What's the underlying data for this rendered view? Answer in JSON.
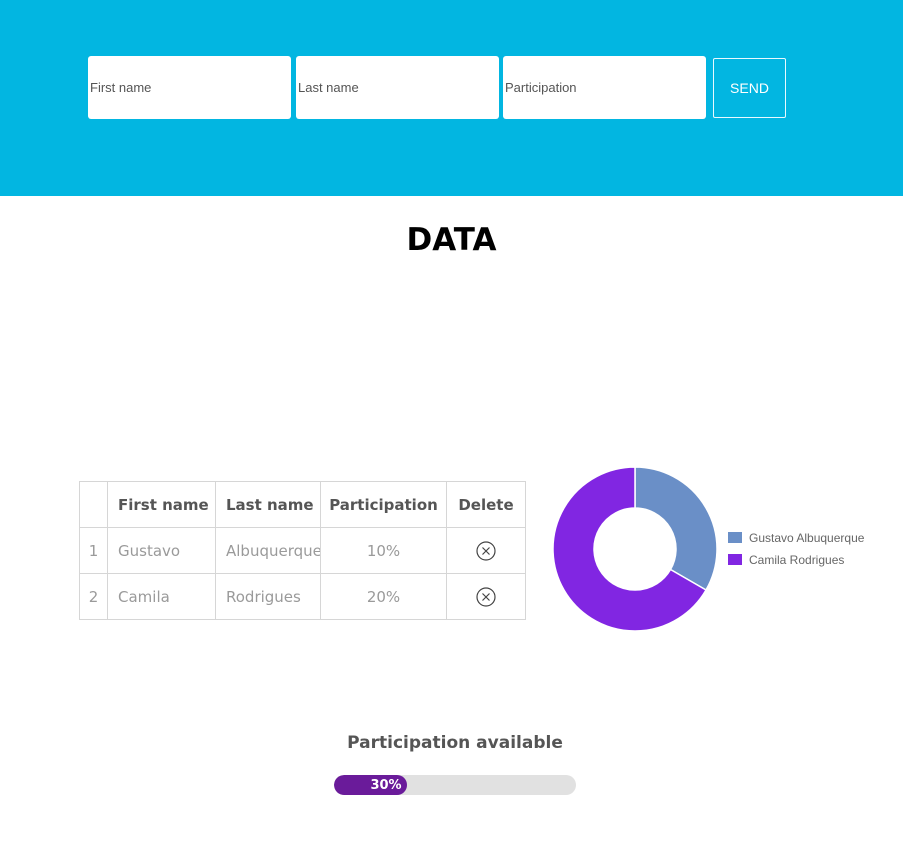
{
  "form": {
    "first_name_placeholder": "First name",
    "last_name_placeholder": "Last name",
    "participation_placeholder": "Participation",
    "send_label": "SEND"
  },
  "colors": {
    "header_bg": "#02b6e1",
    "series_1": "#6a8fc7",
    "series_2": "#8126e2",
    "progress": "#6a1b9a"
  },
  "title": "DATA",
  "table": {
    "headers": [
      "",
      "First name",
      "Last name",
      "Participation",
      "Delete"
    ],
    "rows": [
      {
        "index": "1",
        "first_name": "Gustavo",
        "last_name": "Albuquerque",
        "participation": "10%",
        "delete_icon": "circle-x-icon"
      },
      {
        "index": "2",
        "first_name": "Camila",
        "last_name": "Rodrigues",
        "participation": "20%",
        "delete_icon": "circle-x-icon"
      }
    ]
  },
  "chart_data": {
    "type": "pie",
    "donut": true,
    "categories": [
      "Gustavo Albuquerque",
      "Camila Rodrigues"
    ],
    "values": [
      10,
      20
    ],
    "colors": [
      "#6a8fc7",
      "#8126e2"
    ],
    "legend": "right"
  },
  "progress": {
    "label": "Participation available",
    "value_text": "30%",
    "value": 0.3
  }
}
